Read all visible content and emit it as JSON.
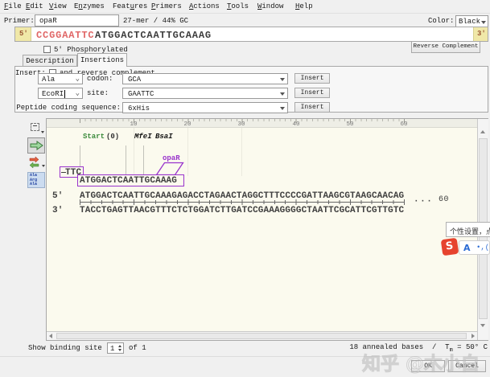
{
  "menu": {
    "items": [
      {
        "pre": "",
        "key": "F",
        "post": "ile"
      },
      {
        "pre": "",
        "key": "E",
        "post": "dit"
      },
      {
        "pre": "",
        "key": "V",
        "post": "iew"
      },
      {
        "pre": "E",
        "key": "n",
        "post": "zymes"
      },
      {
        "pre": "Feat",
        "key": "u",
        "post": "res"
      },
      {
        "pre": "",
        "key": "P",
        "post": "rimers"
      },
      {
        "pre": "",
        "key": "A",
        "post": "ctions"
      },
      {
        "pre": "",
        "key": "T",
        "post": "ools"
      },
      {
        "pre": "",
        "key": "W",
        "post": "indow"
      },
      {
        "pre": "",
        "key": "H",
        "post": "elp"
      }
    ]
  },
  "primer_row": {
    "label": "Primer:",
    "name_value": "opaR",
    "stats": "27-mer  /  44% GC",
    "color_label": "Color:",
    "color_value": "Black"
  },
  "sequence_strip": {
    "five_prime": "5'",
    "tail": "CCGGAATTC",
    "annealed": "ATGGACTCAATTGCAAAG",
    "three_prime": "3'"
  },
  "phosphorylated_label": "5' Phosphorylated",
  "reverse_complement_button": "Reverse Complement",
  "tabs": {
    "description": "Description",
    "insertions": "Insertions"
  },
  "insert_panel": {
    "insert_label": "Insert:",
    "reverse_label": "and reverse complement",
    "rows": [
      {
        "combo": "Ala",
        "label": "codon:",
        "value": "GCA",
        "button": "Insert"
      },
      {
        "combo": "EcoRI",
        "label": "site:",
        "value": "GAATTC",
        "button": "Insert"
      },
      {
        "label": "Peptide coding sequence:",
        "value": "6xHis",
        "button": "Insert"
      }
    ]
  },
  "sequence_view": {
    "ruler_labels": [
      "10",
      "20",
      "30",
      "40",
      "50",
      "60"
    ],
    "annotations": {
      "start_label": "Start",
      "start_value": "(0)",
      "enzyme1": "MfeI",
      "enzyme2": "BsaI",
      "primer_name": "opaR",
      "tail_text": "TTC",
      "primer_text": "ATGGACTCAATTGCAAAG"
    },
    "top_strand_label": "5'",
    "top_strand": "ATGGACTCAATTGCAAAGAGACCTAGAACTAGGCTTTCCCCGATTAAGCGTAAGCAACAG",
    "bottom_strand_label": "3'",
    "bottom_strand": "TACCTGAGTTAACGTTTCTCTGGATCTTGATCCGAAAGGGGCTAATTCGCATTCGTTGTC",
    "ellipsis": "···",
    "end_number": "60"
  },
  "toolbar_icon4_lines": [
    "Ala",
    "Arg",
    "Ala"
  ],
  "status_bar": {
    "binding_label": "Show binding site",
    "binding_value": "1",
    "binding_total": "of 1",
    "annealed": "18 annealed bases",
    "separator": "/",
    "tm_symbol": "T",
    "tm_sub": "m",
    "tm_value": " = 50° C"
  },
  "footer": {
    "ok": "OK",
    "cancel": "Cancel"
  },
  "overlay": {
    "tooltip": "个性设置，点",
    "ime_s": "S",
    "ime_a": "A",
    "watermark": "知乎 @木小白"
  },
  "colors": {
    "primer_purple": "#9933cc",
    "start_green": "#3c8b3c",
    "tail_red": "#e06666",
    "badge_yellow": "#f0e8a8",
    "ime_red": "#e6432e",
    "ime_blue": "#2b6bd4"
  }
}
